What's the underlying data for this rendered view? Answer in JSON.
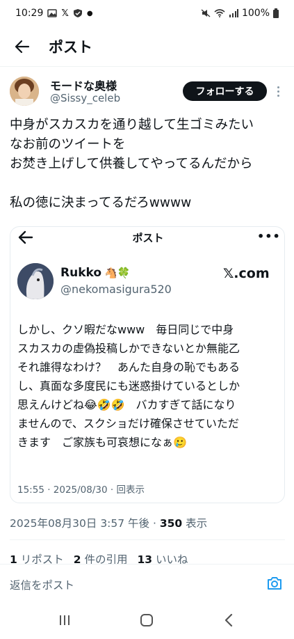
{
  "status_bar": {
    "time": "10:29",
    "battery": "100%"
  },
  "header": {
    "title": "ポスト"
  },
  "author": {
    "name": "モードな奥様",
    "handle": "@Sissy_celeb",
    "follow_label": "フォローする"
  },
  "tweet": {
    "text": "中身がスカスカを通り越して生ゴミみたい\nなお前のツイートを\nお焚き上げして供養してやってるんだから\n\n私の徳に決まってるだろwwww"
  },
  "quoted": {
    "header_title": "ポスト",
    "name": "Rukko",
    "name_emoji": "🐴🍀",
    "handle": "@nekomasigura520",
    "badge": "𝕏.com",
    "lines": [
      "しかし、クソ暇だなwww　毎日同じで中身",
      "スカスカの虚偽投稿しかできないとか無能乙",
      "それ誰得なわけ？　あんた自身の恥でもある",
      "し、真面な多度民にも迷惑掛けているとしか",
      "思えんけどね😂🤣🤣　バカすぎて話になり",
      "ませんので、スクショだけ確保させていただ",
      "きます　ご家族も可哀想になぁ🥲"
    ],
    "timestamp": "15:55 · 2025/08/30 · 回表示"
  },
  "meta": {
    "date": "2025年08月30日 3:57 午後 · ",
    "views_count": "350",
    "views_label": " 表示"
  },
  "stats": {
    "reposts_count": "1",
    "reposts_label": " リポスト",
    "quotes_count": "2",
    "quotes_label": " 件の引用",
    "likes_count": "13",
    "likes_label": " いいね"
  },
  "reply": {
    "placeholder": "返信をポスト"
  },
  "colors": {
    "text": "#0f1419",
    "muted": "#536471",
    "accent": "#1d9bf0",
    "follow_bg": "#0f1419"
  },
  "icons": [
    "back-arrow-icon",
    "more-vertical-icon",
    "more-horizontal-icon",
    "camera-icon",
    "recent-apps-icon",
    "home-icon",
    "back-nav-icon"
  ]
}
